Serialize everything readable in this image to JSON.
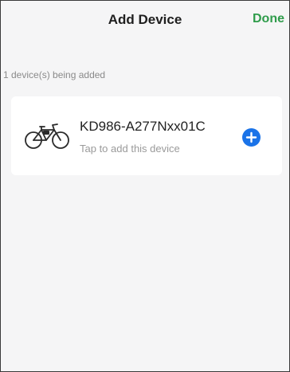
{
  "header": {
    "title": "Add Device",
    "done_label": "Done"
  },
  "status_text": "1 device(s) being added",
  "device": {
    "name": "KD986-A277Nxx01C",
    "subtitle": "Tap to add this device",
    "icon": "bicycle-icon",
    "action_icon": "plus-circle-icon"
  },
  "colors": {
    "accent_green": "#2f9c4b",
    "add_button_blue": "#1a73e8",
    "background": "#f5f5f6"
  }
}
